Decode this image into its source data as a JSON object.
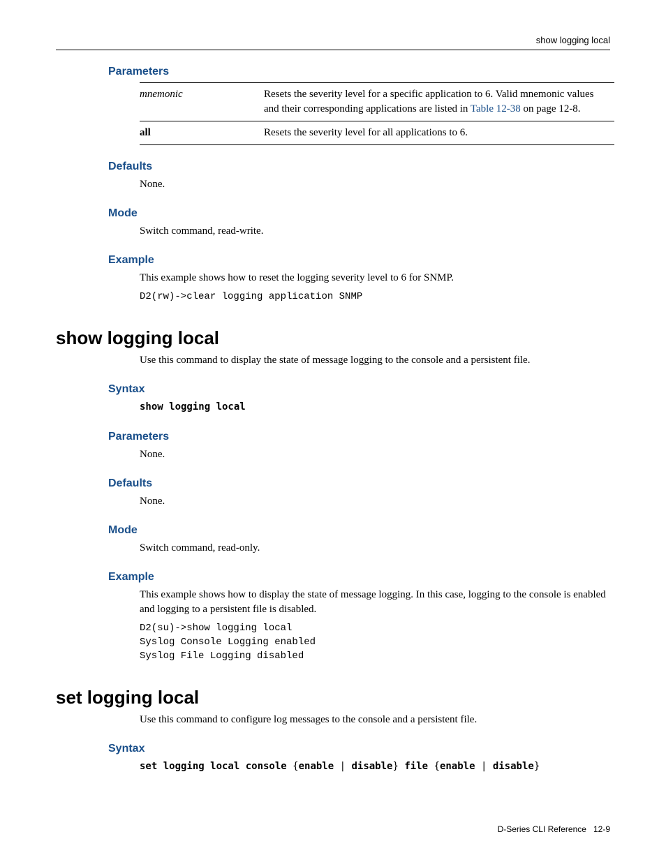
{
  "running_head": "show logging local",
  "section_clear": {
    "parameters_heading": "Parameters",
    "param_rows": [
      {
        "name": "mnemonic",
        "desc_pre": "Resets the severity level for a specific application to 6. Valid mnemonic values and their corresponding applications are listed in ",
        "desc_link": "Table 12-38",
        "desc_post": " on page 12-8."
      },
      {
        "name": "all",
        "desc": "Resets the severity level for all applications to 6."
      }
    ],
    "defaults_heading": "Defaults",
    "defaults_text": "None.",
    "mode_heading": "Mode",
    "mode_text": "Switch command, read-write.",
    "example_heading": "Example",
    "example_text": "This example shows how to reset the logging severity level to 6 for SNMP.",
    "example_code": "D2(rw)->clear logging application SNMP"
  },
  "section_show": {
    "title": "show logging local",
    "intro": "Use this command to display the state of message logging to the console and a persistent file.",
    "syntax_heading": "Syntax",
    "syntax_code": "show logging local",
    "parameters_heading": "Parameters",
    "parameters_text": "None.",
    "defaults_heading": "Defaults",
    "defaults_text": "None.",
    "mode_heading": "Mode",
    "mode_text": "Switch command, read-only.",
    "example_heading": "Example",
    "example_text": "This example shows how to display the state of message logging. In this case, logging to the console is enabled and logging to a persistent file is disabled.",
    "example_code": "D2(su)->show logging local\nSyslog Console Logging enabled\nSyslog File Logging disabled"
  },
  "section_set": {
    "title": "set logging local",
    "intro": "Use this command to configure log messages to the console and a persistent file.",
    "syntax_heading": "Syntax",
    "syntax_parts": {
      "p1": "set logging local console",
      "b1": "{",
      "p2": "enable",
      "b2": " | ",
      "p3": "disable",
      "b3": "}",
      "p4": " file",
      "b4": " {",
      "p5": "enable",
      "b5": " | ",
      "p6": "disable",
      "b6": "}"
    }
  },
  "footer": {
    "doc": "D-Series CLI Reference",
    "page": "12-9"
  }
}
